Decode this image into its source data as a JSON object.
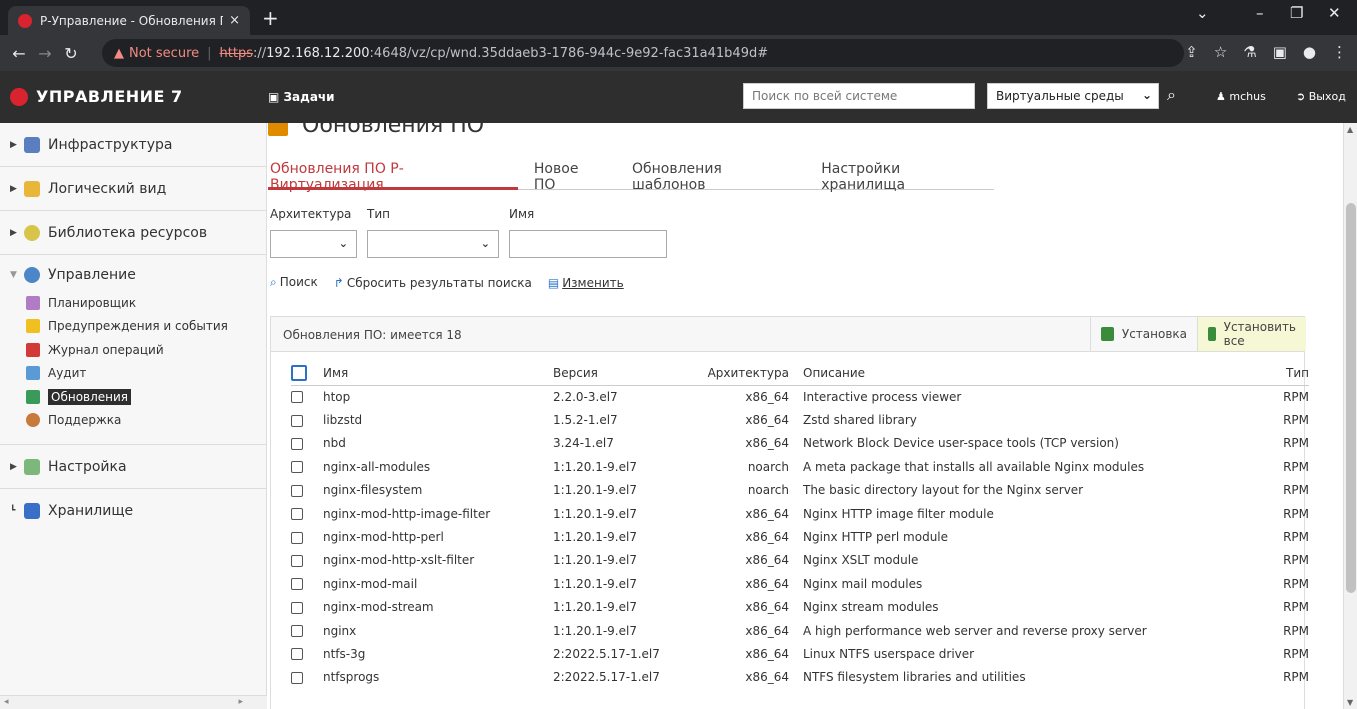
{
  "browser": {
    "tab_title": "Р-Управление - Обновления ПС",
    "tab_close": "×",
    "new_tab": "+",
    "url_warning": "Not secure",
    "url_protocol": "https",
    "url_host": "192.168.12.200",
    "url_path": ":4648/vz/cp/wnd.35ddaeb3-1786-944c-9e92-fac31a41b49d#"
  },
  "header": {
    "app_name": "УПРАВЛЕНИЕ 7",
    "tasks_label": "Задачи",
    "search_placeholder": "Поиск по всей системе",
    "scope_value": "Виртуальные среды",
    "user_name": "mchus",
    "logout_label": "Выход"
  },
  "sidebar": {
    "infrastructure": "Инфраструктура",
    "logical_view": "Логический вид",
    "resource_library": "Библиотека ресурсов",
    "management": "Управление",
    "management_items": [
      {
        "label": "Планировщик"
      },
      {
        "label": "Предупреждения и события"
      },
      {
        "label": "Журнал операций"
      },
      {
        "label": "Аудит"
      },
      {
        "label": "Обновления"
      },
      {
        "label": "Поддержка"
      }
    ],
    "settings": "Настройка",
    "storage": "Хранилище"
  },
  "page": {
    "title": "Обновления ПО",
    "tabs": [
      {
        "label": "Обновления ПО Р-Виртуализация"
      },
      {
        "label": "Новое ПО"
      },
      {
        "label": "Обновления шаблонов"
      },
      {
        "label": "Настройки хранилища"
      }
    ],
    "filter_arch_label": "Архитектура",
    "filter_type_label": "Тип",
    "filter_name_label": "Имя",
    "search_button": "Поиск",
    "reset_button": "Сбросить результаты поиска",
    "change_button": "Изменить",
    "panel_title": "Обновления ПО: имеется 18",
    "install_button": "Установка",
    "install_all_button": "Установить все",
    "columns": {
      "name": "Имя",
      "version": "Версия",
      "arch": "Архитектура",
      "desc": "Описание",
      "type": "Тип"
    },
    "rows": [
      {
        "name": "htop",
        "version": "2.2.0-3.el7",
        "arch": "x86_64",
        "desc": "Interactive process viewer",
        "type": "RPM"
      },
      {
        "name": "libzstd",
        "version": "1.5.2-1.el7",
        "arch": "x86_64",
        "desc": "Zstd shared library",
        "type": "RPM"
      },
      {
        "name": "nbd",
        "version": "3.24-1.el7",
        "arch": "x86_64",
        "desc": "Network Block Device user-space tools (TCP version)",
        "type": "RPM"
      },
      {
        "name": "nginx-all-modules",
        "version": "1:1.20.1-9.el7",
        "arch": "noarch",
        "desc": "A meta package that installs all available Nginx modules",
        "type": "RPM"
      },
      {
        "name": "nginx-filesystem",
        "version": "1:1.20.1-9.el7",
        "arch": "noarch",
        "desc": "The basic directory layout for the Nginx server",
        "type": "RPM"
      },
      {
        "name": "nginx-mod-http-image-filter",
        "version": "1:1.20.1-9.el7",
        "arch": "x86_64",
        "desc": "Nginx HTTP image filter module",
        "type": "RPM"
      },
      {
        "name": "nginx-mod-http-perl",
        "version": "1:1.20.1-9.el7",
        "arch": "x86_64",
        "desc": "Nginx HTTP perl module",
        "type": "RPM"
      },
      {
        "name": "nginx-mod-http-xslt-filter",
        "version": "1:1.20.1-9.el7",
        "arch": "x86_64",
        "desc": "Nginx XSLT module",
        "type": "RPM"
      },
      {
        "name": "nginx-mod-mail",
        "version": "1:1.20.1-9.el7",
        "arch": "x86_64",
        "desc": "Nginx mail modules",
        "type": "RPM"
      },
      {
        "name": "nginx-mod-stream",
        "version": "1:1.20.1-9.el7",
        "arch": "x86_64",
        "desc": "Nginx stream modules",
        "type": "RPM"
      },
      {
        "name": "nginx",
        "version": "1:1.20.1-9.el7",
        "arch": "x86_64",
        "desc": "A high performance web server and reverse proxy server",
        "type": "RPM"
      },
      {
        "name": "ntfs-3g",
        "version": "2:2022.5.17-1.el7",
        "arch": "x86_64",
        "desc": "Linux NTFS userspace driver",
        "type": "RPM"
      },
      {
        "name": "ntfsprogs",
        "version": "2:2022.5.17-1.el7",
        "arch": "x86_64",
        "desc": "NTFS filesystem libraries and utilities",
        "type": "RPM"
      }
    ]
  }
}
